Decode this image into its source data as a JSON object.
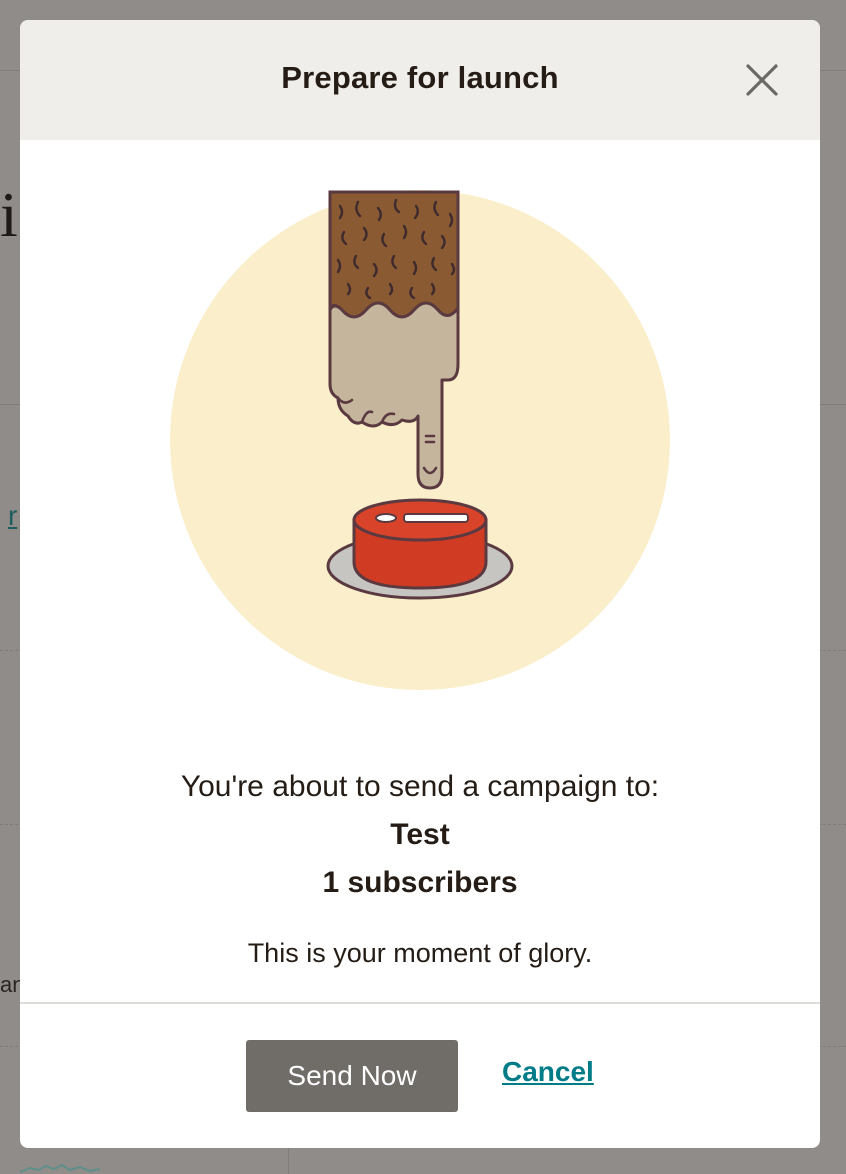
{
  "modal": {
    "title": "Prepare for launch",
    "close_icon": "close-icon",
    "illustration": "finger-pressing-red-button-illustration",
    "intro_text": "You're about to send a campaign to:",
    "list_name": "Test",
    "subscriber_count": "1 subscribers",
    "tagline": "This is your moment of glory.",
    "send_label": "Send Now",
    "cancel_label": "Cancel"
  },
  "background": {
    "heading_fragment": "i",
    "link_fragment": "r",
    "text_fragment": "an"
  },
  "colors": {
    "overlay": "#8f8c89",
    "header_bg": "#efeeea",
    "send_button": "#706c68",
    "cancel_link": "#007c89",
    "illustration_circle": "#fbeecb",
    "button_red": "#cf3b23",
    "sleeve_brown": "#8a5a33",
    "hand_tan": "#c5b59d",
    "outline": "#5a3a40"
  }
}
